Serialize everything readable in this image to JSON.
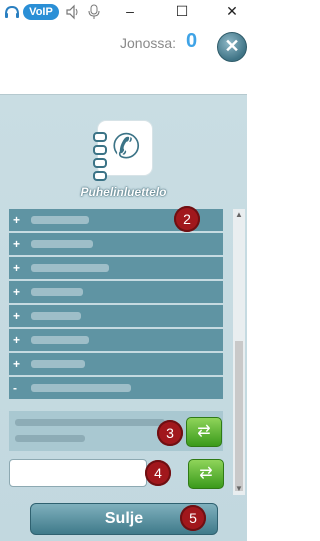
{
  "titlebar": {
    "voip_badge": "VoIP",
    "minimize_glyph": "–",
    "maximize_glyph": "☐",
    "close_glyph": "✕"
  },
  "header": {
    "queue_label": "Jonossa:",
    "queue_count": "0",
    "close_glyph": "✕"
  },
  "phonebook": {
    "title": "Puhelinluettelo",
    "groups": [
      {
        "sign": "+",
        "label": ""
      },
      {
        "sign": "+",
        "label": ""
      },
      {
        "sign": "+",
        "label": ""
      },
      {
        "sign": "+",
        "label": ""
      },
      {
        "sign": "+",
        "label": ""
      },
      {
        "sign": "+",
        "label": ""
      },
      {
        "sign": "+",
        "label": ""
      },
      {
        "sign": "-",
        "label": ""
      }
    ]
  },
  "callouts": [
    "2",
    "3",
    "4",
    "5"
  ],
  "dial": {
    "input_value": "",
    "call_glyph": "⇄"
  },
  "footer": {
    "close_label": "Sulje"
  },
  "colors": {
    "accent": "#3fa3e6",
    "row": "#5f94a3",
    "badge": "#a1171c",
    "call_green": "#3a9a1b"
  }
}
